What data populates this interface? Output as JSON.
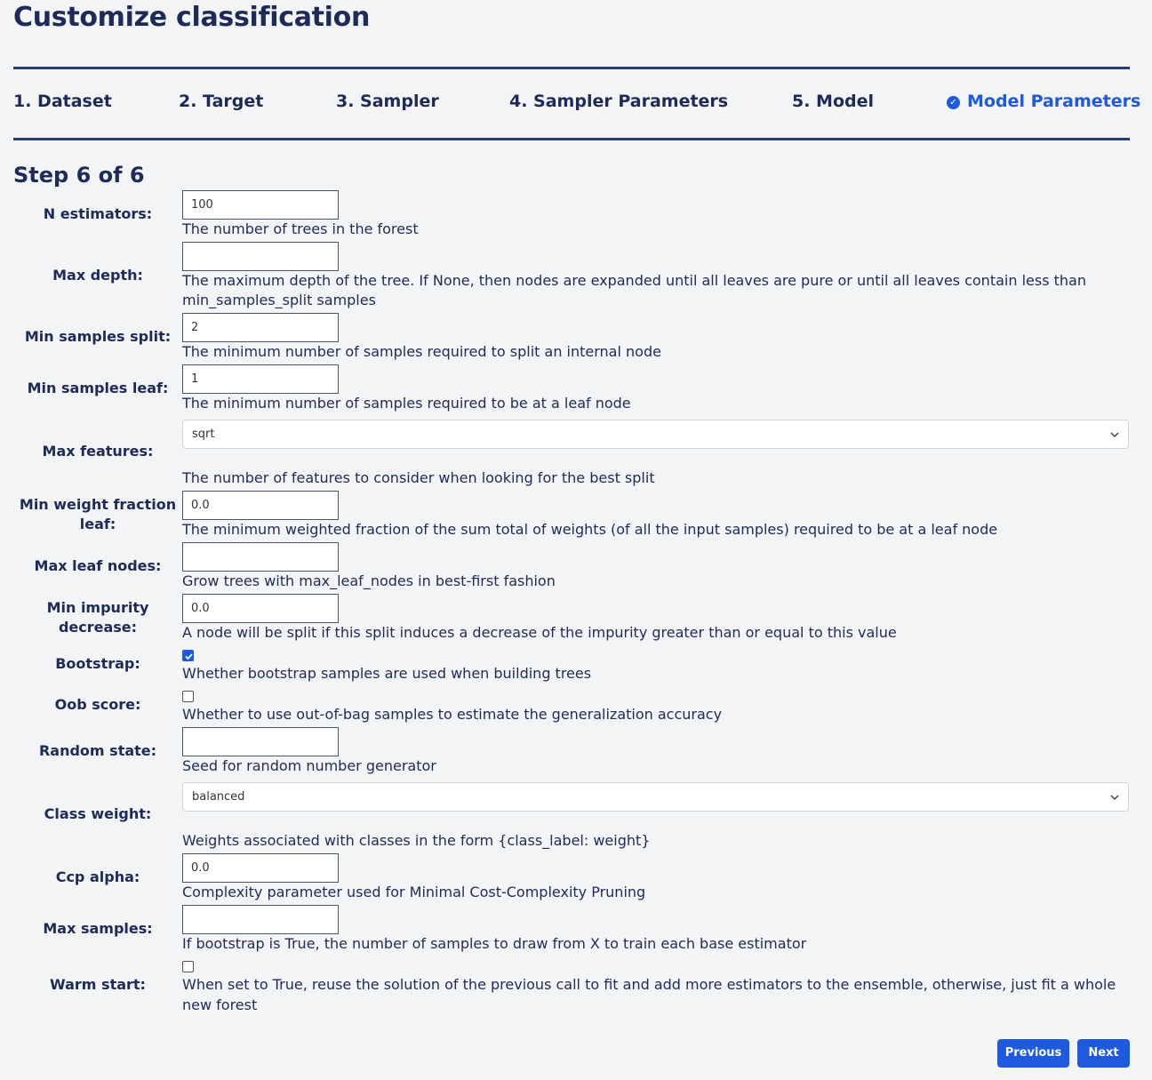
{
  "page_title": "Customize classification",
  "steps": [
    {
      "label": "1. Dataset"
    },
    {
      "label": "2. Target"
    },
    {
      "label": "3. Sampler"
    },
    {
      "label": "4. Sampler Parameters"
    },
    {
      "label": "5. Model"
    },
    {
      "label": "Model Parameters",
      "active": true,
      "icon": "check-circle-icon"
    }
  ],
  "step_count": "Step 6 of 6",
  "fields": {
    "n_estimators": {
      "label": "N estimators:",
      "value": "100",
      "help": "The number of trees in the forest"
    },
    "max_depth": {
      "label": "Max depth:",
      "value": "",
      "help_line1": "The maximum depth of the tree. If None, then nodes are expanded until all leaves are pure or until all leaves contain less than",
      "help_line2": "min_samples_split samples"
    },
    "min_samples_split": {
      "label": "Min samples split:",
      "value": "2",
      "help": "The minimum number of samples required to split an internal node"
    },
    "min_samples_leaf": {
      "label": "Min samples leaf:",
      "value": "1",
      "help": "The minimum number of samples required to be at a leaf node"
    },
    "max_features": {
      "label": "Max features:",
      "value": "sqrt",
      "help": "The number of features to consider when looking for the best split"
    },
    "min_weight_fraction_leaf": {
      "label_line1": "Min weight fraction",
      "label_line2": "leaf:",
      "value": "0.0",
      "help": "The minimum weighted fraction of the sum total of weights (of all the input samples) required to be at a leaf node"
    },
    "max_leaf_nodes": {
      "label": "Max leaf nodes:",
      "value": "",
      "help": "Grow trees with max_leaf_nodes in best-first fashion"
    },
    "min_impurity_decrease": {
      "label_line1": "Min impurity",
      "label_line2": "decrease:",
      "value": "0.0",
      "help": "A node will be split if this split induces a decrease of the impurity greater than or equal to this value"
    },
    "bootstrap": {
      "label": "Bootstrap:",
      "checked": true,
      "help": "Whether bootstrap samples are used when building trees"
    },
    "oob_score": {
      "label": "Oob score:",
      "checked": false,
      "help": "Whether to use out-of-bag samples to estimate the generalization accuracy"
    },
    "random_state": {
      "label": "Random state:",
      "value": "",
      "help": "Seed for random number generator"
    },
    "class_weight": {
      "label": "Class weight:",
      "value": "balanced",
      "help": "Weights associated with classes in the form {class_label: weight}"
    },
    "ccp_alpha": {
      "label": "Ccp alpha:",
      "value": "0.0",
      "help": "Complexity parameter used for Minimal Cost-Complexity Pruning"
    },
    "max_samples": {
      "label": "Max samples:",
      "value": "",
      "help": "If bootstrap is True, the number of samples to draw from X to train each base estimator"
    },
    "warm_start": {
      "label": "Warm start:",
      "checked": false,
      "help_line1": "When set to True, reuse the solution of the previous call to fit and add more estimators to the ensemble, otherwise, just fit a whole",
      "help_line2": "new forest"
    }
  },
  "buttons": {
    "previous": "Previous",
    "next": "Next"
  },
  "colors": {
    "heading": "#1e2b58",
    "accent": "#1d5ae0",
    "background": "#f3f4f6"
  }
}
